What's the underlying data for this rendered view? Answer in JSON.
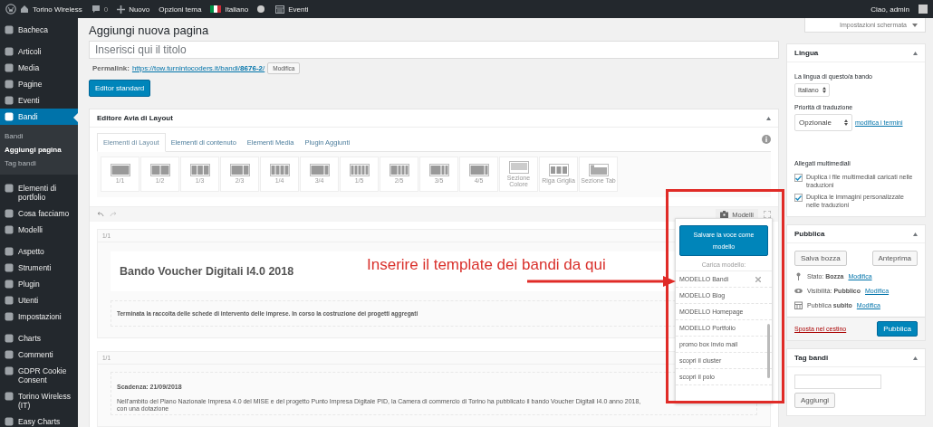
{
  "admin_bar": {
    "site": "Torino Wireless",
    "comments": "0",
    "new": "Nuovo",
    "theme_options": "Opzioni tema",
    "language": "Italiano",
    "events": "Eventi",
    "greeting": "Ciao, admin"
  },
  "sidebar": {
    "groups": [
      {
        "items": [
          {
            "label": "Bacheca",
            "selected": false
          }
        ]
      },
      {
        "items": [
          {
            "label": "Articoli",
            "selected": false
          },
          {
            "label": "Media",
            "selected": false
          },
          {
            "label": "Pagine",
            "selected": false
          },
          {
            "label": "Eventi",
            "selected": false
          },
          {
            "label": "Bandi",
            "selected": true,
            "children": [
              {
                "label": "Bandi",
                "selected": false
              },
              {
                "label": "Aggiungi pagina",
                "selected": true
              },
              {
                "label": "Tag bandi",
                "selected": false
              }
            ]
          }
        ]
      },
      {
        "items": [
          {
            "label": "Elementi di portfolio",
            "selected": false
          },
          {
            "label": "Cosa facciamo",
            "selected": false
          },
          {
            "label": "Modelli",
            "selected": false
          }
        ]
      },
      {
        "items": [
          {
            "label": "Aspetto",
            "selected": false
          },
          {
            "label": "Strumenti",
            "selected": false
          },
          {
            "label": "Plugin",
            "selected": false
          },
          {
            "label": "Utenti",
            "selected": false
          },
          {
            "label": "Impostazioni",
            "selected": false
          }
        ]
      },
      {
        "items": [
          {
            "label": "Charts",
            "selected": false
          },
          {
            "label": "Commenti",
            "selected": false
          },
          {
            "label": "GDPR Cookie Consent",
            "selected": false
          },
          {
            "label": "Torino Wireless (IT)",
            "selected": false
          },
          {
            "label": "Easy Charts",
            "selected": false
          }
        ]
      }
    ]
  },
  "page_title": "Aggiungi nuova pagina",
  "title_field": {
    "placeholder": "Inserisci qui il titolo"
  },
  "permalink": {
    "label": "Permalink:",
    "url": "https://tow.turnintocoders.it/bandi/**8676-2**/",
    "button": "Modifica"
  },
  "editor_button": "Editor standard",
  "layout_editor": {
    "title": "Editore Avia di Layout",
    "tabs": [
      {
        "label": "Elementi di Layout",
        "selected": true
      },
      {
        "label": "Elementi di contenuto",
        "selected": false
      },
      {
        "label": "Elementi Media",
        "selected": false
      },
      {
        "label": "Plugin Aggiunti",
        "selected": false
      }
    ],
    "elements": [
      {
        "label": "1/1"
      },
      {
        "label": "1/2"
      },
      {
        "label": "1/3"
      },
      {
        "label": "2/3"
      },
      {
        "label": "1/4"
      },
      {
        "label": "3/4"
      },
      {
        "label": "1/5"
      },
      {
        "label": "2/5"
      },
      {
        "label": "3/5"
      },
      {
        "label": "4/5"
      },
      {
        "label": "Sezione Colore"
      },
      {
        "label": "Riga Griglia"
      },
      {
        "label": "Sezione Tab"
      }
    ],
    "templates_button": "Modelli"
  },
  "sections": [
    {
      "label": "1/1",
      "blocks": [
        {
          "kind": "heading",
          "text": "Bando Voucher Digitali I4.0 2018"
        },
        {
          "kind": "text",
          "text": "Terminata la raccolta delle schede di intervento delle imprese. In corso la costruzione dei progetti aggregati"
        }
      ]
    },
    {
      "label": "1/1",
      "blocks": [
        {
          "kind": "notice",
          "heading": "Scadenza: 21/09/2018",
          "text": "Nell'ambito del Piano Nazionale Impresa 4.0 del MISE e del progetto Punto Impresa Digitale PID, la Camera di commercio di Torino ha pubblicato il bando Voucher Digitali I4.0 anno 2018, con una dotazione"
        }
      ]
    }
  ],
  "templates_popup": {
    "save_button": "Salvare la voce come modello",
    "load_label": "Carica modello:",
    "items": [
      {
        "label": "MODELLO Bandi",
        "hovered": true
      },
      {
        "label": "MODELLO Blog",
        "hovered": false
      },
      {
        "label": "MODELLO Homepage",
        "hovered": false
      },
      {
        "label": "MODELLO Portfolio",
        "hovered": false
      },
      {
        "label": "promo box invio mail",
        "hovered": false
      },
      {
        "label": "scopri il cluster",
        "hovered": false
      },
      {
        "label": "scopri il polo",
        "hovered": false
      }
    ]
  },
  "annotation": {
    "text": "Inserire il template dei bandi da qui"
  },
  "screen_options": "Impostazioni schermata",
  "language_box": {
    "title": "Lingua",
    "language_label": "La lingua di questo/a bando",
    "language": "Italiano",
    "priority_label": "Priorità di traduzione",
    "priority": "Opzionale",
    "terms_link": "modifica i termini",
    "media_title": "Allegati multimediali",
    "checkboxes": [
      {
        "label": "Duplica i file multimediali caricati nelle traduzioni",
        "checked": true
      },
      {
        "label": "Duplica le immagini personalizzate nelle traduzioni",
        "checked": true
      }
    ]
  },
  "publish_box": {
    "title": "Pubblica",
    "save_draft": "Salva bozza",
    "preview": "Anteprima",
    "rows": [
      {
        "kind": "status",
        "text": "Stato: **Bozza**",
        "link": "Modifica"
      },
      {
        "kind": "visibility",
        "text": "Visibilità: **Pubblico**",
        "link": "Modifica"
      },
      {
        "kind": "schedule",
        "text": "Pubblica **subito**",
        "link": "Modifica"
      }
    ],
    "trash": "Sposta nel cestino",
    "publish": "Pubblica"
  },
  "tags_box": {
    "title": "Tag bandi",
    "add": "Aggiungi"
  }
}
